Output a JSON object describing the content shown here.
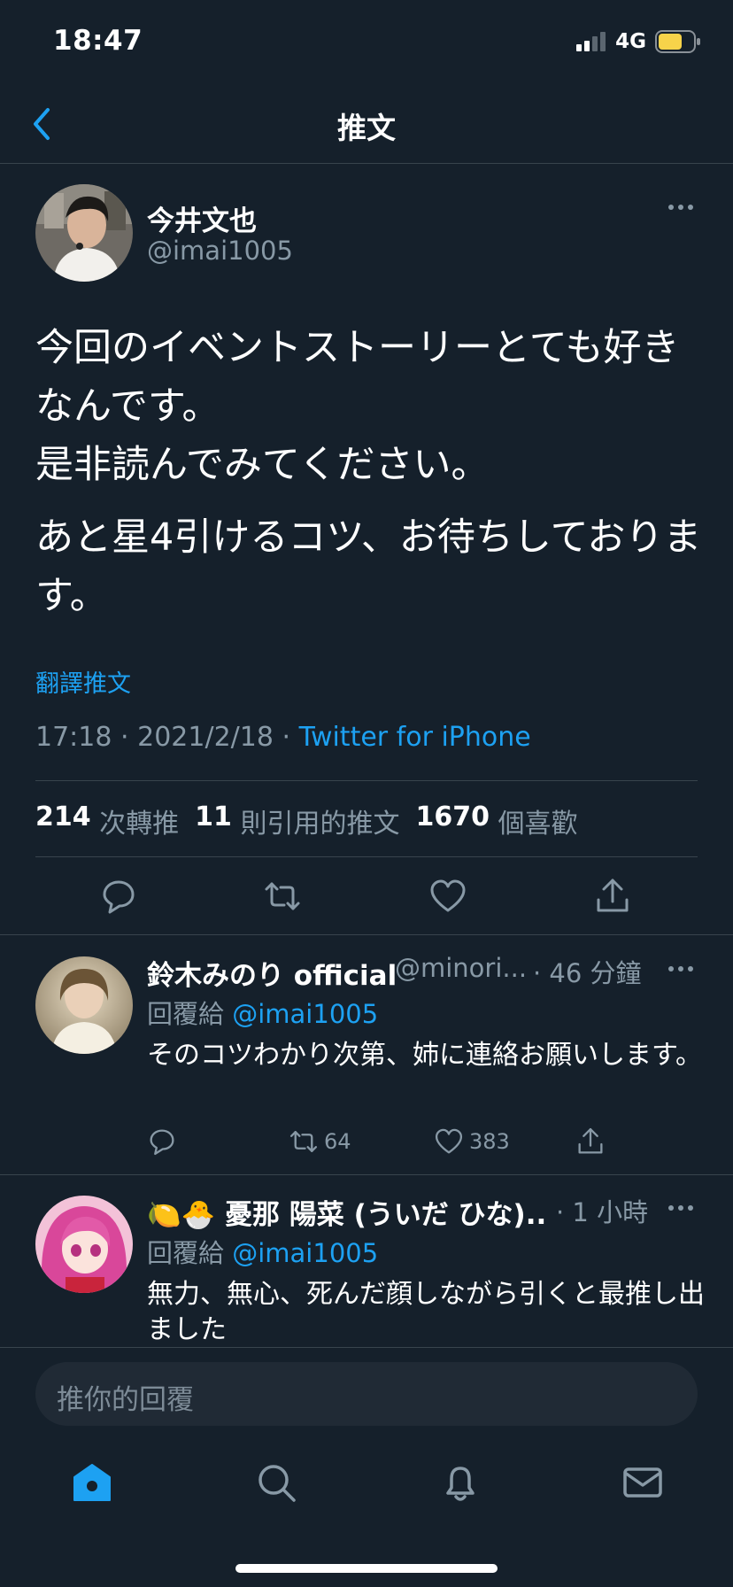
{
  "status_bar": {
    "time": "18:47",
    "network": "4G"
  },
  "nav": {
    "title": "推文"
  },
  "tweet": {
    "author_name": "今井文也",
    "author_handle": "@imai1005",
    "paragraphs": [
      "今回のイベントストーリーとても好きなんです。\n是非読んでみてください。",
      "あと星4引けるコツ、お待ちしております。"
    ],
    "translate_label": "翻譯推文",
    "time": "17:18",
    "date": "2021/2/18",
    "separator": "·",
    "source": "Twitter for iPhone",
    "stats": {
      "retweets": "214",
      "retweets_label": "次轉推",
      "quotes": "11",
      "quotes_label": "則引用的推文",
      "likes": "1670",
      "likes_label": "個喜歡"
    }
  },
  "replies": [
    {
      "name": "鈴木みのり official",
      "handle": "@minori...",
      "time": "· 46 分鐘",
      "reply_to_prefix": "回覆給",
      "reply_to": "@imai1005",
      "text": "そのコツわかり次第、姉に連絡お願いします。",
      "retweets": "64",
      "likes": "383"
    },
    {
      "name": "🍋🐣 憂那 陽菜 (ういだ ひな)...",
      "time": "· 1 小時",
      "reply_to_prefix": "回覆給",
      "reply_to": "@imai1005",
      "text": "無力、無心、死んだ顔しながら引くと最推し出ました"
    }
  ],
  "composer": {
    "placeholder": "推你的回覆"
  },
  "tabs": [
    "home-icon",
    "search-icon",
    "notifications-icon",
    "messages-icon"
  ],
  "colors": {
    "background": "#15202b",
    "accent": "#1da1f2",
    "muted": "#8899a6",
    "divider": "#38444d"
  }
}
